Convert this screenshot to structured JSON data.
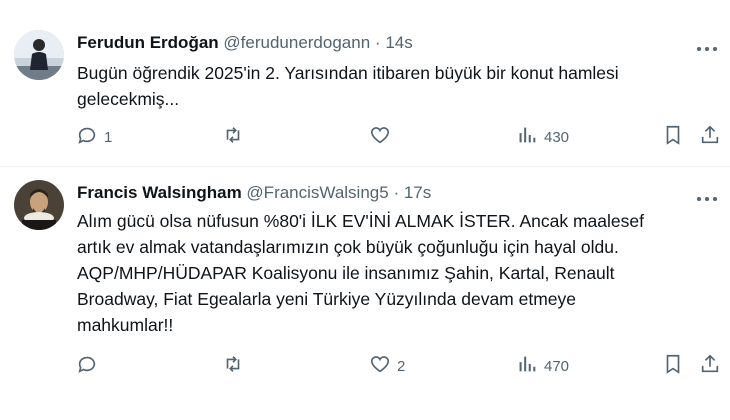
{
  "tweets": [
    {
      "name": "Ferudun Erdoğan",
      "handle": "@ferudunerdogann",
      "separator": "·",
      "time": "14s",
      "text_lines": [
        "Bugün öğrendik 2025'in 2. Yarısından itibaren büyük bir konut hamlesi",
        "gelecekmiş..."
      ],
      "replies": "1",
      "retweets": "",
      "likes": "",
      "views": "430"
    },
    {
      "name": "Francis Walsingham",
      "handle": "@FrancisWalsing5",
      "separator": "·",
      "time": "17s",
      "text_lines": [
        "Alım gücü olsa nüfusun %80'i İLK EV'İNİ ALMAK İSTER. Ancak maalesef",
        "artık ev almak vatandaşlarımızın çok büyük çoğunluğu için hayal oldu.",
        "AQP/MHP/HÜDAPAR Koalisyonu ile insanımız Şahin, Kartal, Renault",
        "Broadway, Fiat Egealarla yeni Türkiye Yüzyılında devam etmeye",
        "mahkumlar!!"
      ],
      "replies": "",
      "retweets": "",
      "likes": "2",
      "views": "470"
    }
  ],
  "icons": {
    "reply": "reply-icon",
    "retweet": "retweet-icon",
    "like": "heart-icon",
    "views": "views-icon",
    "bookmark": "bookmark-icon",
    "share": "share-icon",
    "more": "more-icon"
  },
  "colors": {
    "text": "#0f1419",
    "secondary": "#536471",
    "divider": "#eff3f4",
    "background": "#ffffff"
  }
}
